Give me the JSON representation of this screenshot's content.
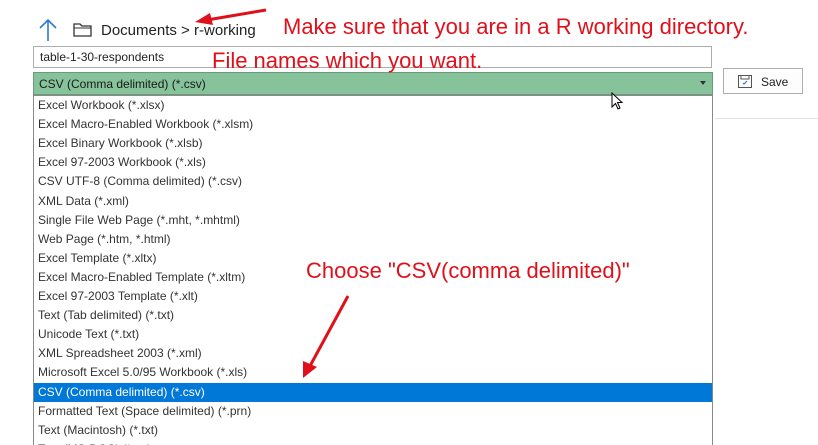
{
  "nav": {
    "breadcrumb": [
      "Documents",
      ">",
      "r-working"
    ]
  },
  "filename": {
    "value": "table-1-30-respondents"
  },
  "save_as_type": {
    "selected": "CSV (Comma delimited) (*.csv)"
  },
  "save_button": {
    "label": "Save"
  },
  "options": [
    "Excel Workbook (*.xlsx)",
    "Excel Macro-Enabled Workbook (*.xlsm)",
    "Excel Binary Workbook (*.xlsb)",
    "Excel 97-2003 Workbook (*.xls)",
    "CSV UTF-8 (Comma delimited) (*.csv)",
    "XML Data (*.xml)",
    "Single File Web Page (*.mht, *.mhtml)",
    "Web Page (*.htm, *.html)",
    "Excel Template (*.xltx)",
    "Excel Macro-Enabled Template (*.xltm)",
    "Excel 97-2003 Template (*.xlt)",
    "Text (Tab delimited) (*.txt)",
    "Unicode Text (*.txt)",
    "XML Spreadsheet 2003 (*.xml)",
    "Microsoft Excel 5.0/95 Workbook (*.xls)",
    "CSV (Comma delimited) (*.csv)",
    "Formatted Text (Space delimited) (*.prn)",
    "Text (Macintosh) (*.txt)",
    "Text (MS-DOS) (*.txt)"
  ],
  "selected_option_index": 15,
  "annotations": {
    "working_dir": "Make sure that you are in a R working directory.",
    "file_names": "File names which you want.",
    "choose_csv": "Choose \"CSV(comma delimited)\"",
    "color": "#e0101a"
  },
  "colors": {
    "select_bg": "#86c39a",
    "selected_row": "#0078d7"
  }
}
